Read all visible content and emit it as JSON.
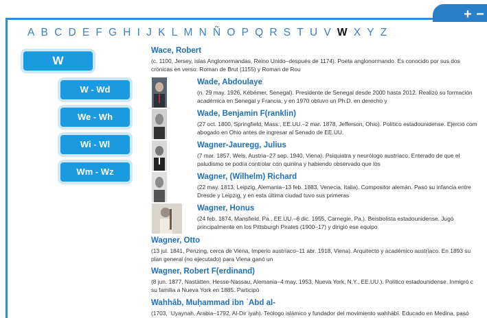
{
  "alphabet": [
    "A",
    "B",
    "C",
    "D",
    "E",
    "F",
    "G",
    "H",
    "I",
    "J",
    "K",
    "L",
    "M",
    "N",
    "Ñ",
    "O",
    "P",
    "Q",
    "R",
    "S",
    "T",
    "U",
    "V",
    "W",
    "X",
    "Y",
    "Z"
  ],
  "active_letter": "W",
  "zoom": {
    "plus": "+",
    "minus": "−"
  },
  "main_button": "W",
  "sub_buttons": [
    "W - Wd",
    "We - Wh",
    "Wi - Wl",
    "Wm - Wz"
  ],
  "entries": [
    {
      "title": "Wace, Robert",
      "line1": "(c. 1100, Jersey, islas Anglonormandas, Reino Unido–después de 1174). Poeta anglonormando. Es conocido por sus dos",
      "line2": "crónicas en verso: Roman de Brut (1155) y Roman de Rou"
    },
    {
      "title": "Wade, Abdoulaye",
      "line1": "(n. 29 may. 1926, Kébémer, Senegal). Presidente de Senegal desde 2000 hasta 2012. Realizó su formación",
      "line2": "académica en Senegal y Francia, y en 1970 obtuvo un Ph.D. en derecho y"
    },
    {
      "title": "Wade, Benjamin F(ranklin)",
      "line1": "(27 oct. 1800, Springfield, Mass., EE.UU.–2 mar. 1878, Jefferson, Ohio). Político estadounidense. Ejerció com",
      "line2": "abogado en Ohio antes de ingresar al Senado de EE.UU."
    },
    {
      "title": "Wagner-Jauregg, Julius",
      "line1": "(7 mar. 1857, Wels, Austria–27 sep. 1940, Viena). Psiquiatra y neurólogo austríaco. Enterado de que el",
      "line2": "paludismo se podía controlar con quinina y habiendo observado que los"
    },
    {
      "title": "Wagner, (Wilhelm) Richard",
      "line1": "(22 may. 1813, Leipzig, Alemania–13 feb. 1883, Venecia, Italia). Compositor alemán. Pasó su infancia entre",
      "line2": "Dresde y Leipzig, y en esta última ciudad tuvo sus primeras"
    },
    {
      "title": "Wagner, Honus",
      "line1": "(24 feb. 1874, Mansfield, Pa., EE.UU.–6 dic. 1955, Carnegie, Pa.). Beisbolista estadounidense. Jugó",
      "line2": "principalmente en los Pittsburgh Pirates (1900–17) y dirigió ese equipo"
    },
    {
      "title": "Wagner, Otto",
      "line1": "(13 jul. 1841, Penzing, cerca de Viena, Imperio austríaco–11 abr. 1918, Viena). Arquitecto y académico austríaco. En 1893 su",
      "line2": "plan general (no ejecutado) para Viena ganó un"
    },
    {
      "title": "Wagner, Robert F(erdinand)",
      "line1": "(8 jun. 1877, Nastätten, Hesse-Nassau, Alemania–4 may. 1953, Nueva York, N.Y., EE.UU.). Político estadounidense. Inmigró c",
      "line2": "su familia a Nueva York en 1885. Participó"
    },
    {
      "title": "Wahhāb, Muḥammad ibn ʿAbd al-",
      "line1": "(1703, ʿUyaynah, Arabia–1792, Al-Dirʿiyah). Teólogo islámico y fundador del movimiento wahhābī. Educado en Medina, pasó",
      "line2": ""
    }
  ]
}
